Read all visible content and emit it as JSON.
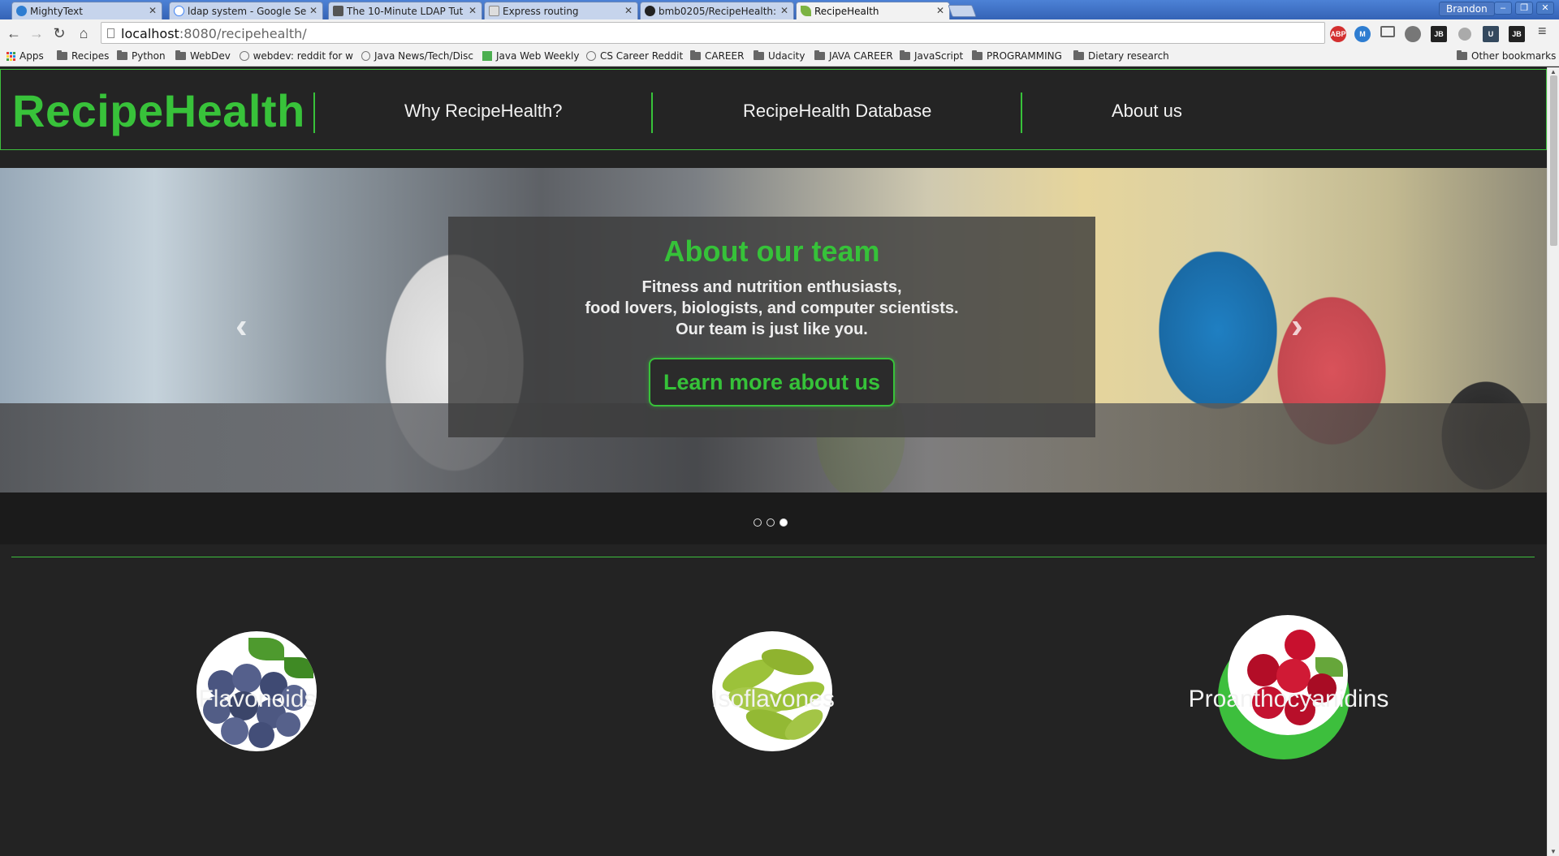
{
  "browser": {
    "tabs": [
      {
        "title": "MightyText",
        "favicon_color": "#2e7dd1"
      },
      {
        "title": "ldap system - Google Se",
        "favicon_color": "#ffffff"
      },
      {
        "title": "The 10-Minute LDAP Tut",
        "favicon_color": "#555555"
      },
      {
        "title": "Express routing",
        "favicon_color": "#dddddd"
      },
      {
        "title": "bmb0205/RecipeHealth:",
        "favicon_color": "#222222"
      },
      {
        "title": "RecipeHealth",
        "favicon_color": "#7cb342"
      }
    ],
    "close_glyph": "✕",
    "profile_name": "Brandon",
    "url_host": "localhost",
    "url_rest": ":8080/recipehealth/",
    "extensions": [
      "ABP",
      "M",
      "",
      "",
      "JB",
      "",
      "U",
      "JB"
    ],
    "bookmarks": [
      {
        "label": "Apps",
        "type": "apps"
      },
      {
        "label": "Recipes",
        "type": "folder"
      },
      {
        "label": "Python",
        "type": "folder"
      },
      {
        "label": "WebDev",
        "type": "folder"
      },
      {
        "label": "webdev: reddit for w",
        "type": "site"
      },
      {
        "label": "Java News/Tech/Disc",
        "type": "site"
      },
      {
        "label": "Java Web Weekly",
        "type": "jw"
      },
      {
        "label": "CS Career Reddit",
        "type": "site"
      },
      {
        "label": "CAREER",
        "type": "folder"
      },
      {
        "label": "Udacity",
        "type": "folder"
      },
      {
        "label": "JAVA CAREER",
        "type": "folder"
      },
      {
        "label": "JavaScript",
        "type": "folder"
      },
      {
        "label": "PROGRAMMING",
        "type": "folder"
      },
      {
        "label": "Dietary research",
        "type": "folder"
      },
      {
        "label": "Other bookmarks",
        "type": "folder"
      }
    ]
  },
  "site": {
    "brand": "RecipeHealth",
    "nav": [
      "Why RecipeHealth?",
      "RecipeHealth Database",
      "About us"
    ],
    "accent_color": "#38c23a",
    "carousel": {
      "title": "About our team",
      "lines": [
        "Fitness and nutrition enthusiasts,",
        "food lovers, biologists, and computer scientists.",
        "Our team is just like you."
      ],
      "cta": "Learn more about us",
      "prev_glyph": "‹",
      "next_glyph": "›",
      "slides": 3,
      "active_slide": 3
    },
    "features": [
      {
        "label": "Flavonoids",
        "image": "blueberries"
      },
      {
        "label": "Isoflavones",
        "image": "edamame"
      },
      {
        "label": "Proanthocyanidins",
        "image": "cranberries"
      }
    ]
  }
}
